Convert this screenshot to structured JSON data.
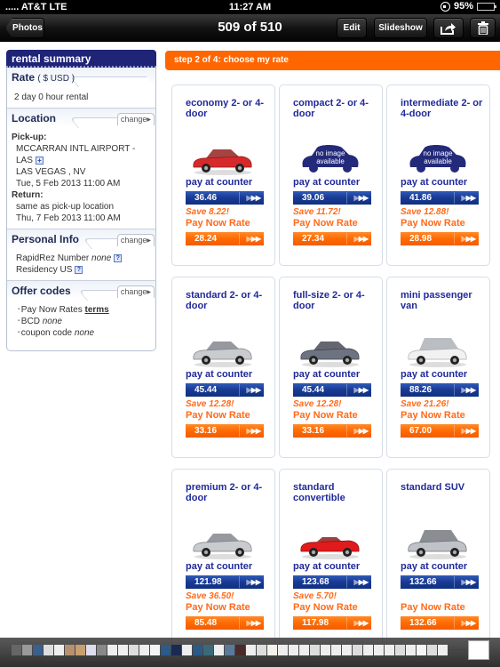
{
  "status_bar": {
    "carrier": "..... AT&T  LTE",
    "time": "11:27 AM",
    "battery": "95%",
    "battery_level": 0.95
  },
  "nav": {
    "back_label": "Photos",
    "title": "509 of 510",
    "edit_label": "Edit",
    "slideshow_label": "Slideshow"
  },
  "sidebar": {
    "header": "rental summary",
    "rate": {
      "title": "Rate",
      "currency": "( $ USD )",
      "duration": "2 day 0 hour rental"
    },
    "location": {
      "title": "Location",
      "change": "change",
      "pickup_label": "Pick-up:",
      "pickup_place_1": "MCCARRAN INTL AIRPORT -",
      "pickup_place_2": "LAS",
      "pickup_city": "LAS VEGAS ,  NV",
      "pickup_time": "Tue, 5 Feb 2013 11:00 AM",
      "return_label": "Return:",
      "return_place": "same as pick-up location",
      "return_time": "Thu, 7 Feb 2013 11:00 AM"
    },
    "personal": {
      "title": "Personal Info",
      "change": "change",
      "rapidrez_label": "RapidRez Number",
      "rapidrez_value": "none",
      "residency": "Residency US"
    },
    "offers": {
      "title": "Offer codes",
      "change": "change",
      "pay_now_label": "Pay Now Rates",
      "terms_link": "terms",
      "bcd_label": "BCD",
      "bcd_value": "none",
      "coupon_label": "coupon code",
      "coupon_value": "none"
    }
  },
  "main": {
    "step_title": "step 2 of 4: choose my rate",
    "pay_at_counter_label": "pay at counter",
    "pay_now_label": "Pay Now Rate",
    "cars": [
      {
        "name": "economy 2- or 4-door",
        "image": "red-sedan",
        "counter_price": "36.46",
        "save": "Save 8.22!",
        "pay_now_price": "28.24"
      },
      {
        "name": "compact 2- or 4-door",
        "image": "no-image",
        "counter_price": "39.06",
        "save": "Save 11.72!",
        "pay_now_price": "27.34"
      },
      {
        "name": "intermediate 2- or 4-door",
        "image": "no-image",
        "counter_price": "41.86",
        "save": "Save 12.88!",
        "pay_now_price": "28.98"
      },
      {
        "name": "standard 2- or 4-door",
        "image": "silver-sedan",
        "counter_price": "45.44",
        "save": "Save 12.28!",
        "pay_now_price": "33.16"
      },
      {
        "name": "full-size 2- or 4-door",
        "image": "gray-sedan",
        "counter_price": "45.44",
        "save": "Save 12.28!",
        "pay_now_price": "33.16"
      },
      {
        "name": "mini passenger van",
        "image": "white-van",
        "counter_price": "88.26",
        "save": "Save 21.26!",
        "pay_now_price": "67.00"
      },
      {
        "name": "premium 2- or 4-door",
        "image": "silver-sedan",
        "counter_price": "121.98",
        "save": "Save 36.50!",
        "pay_now_price": "85.48"
      },
      {
        "name": "standard convertible",
        "image": "red-convertible",
        "counter_price": "123.68",
        "save": "Save 5.70!",
        "pay_now_price": "117.98"
      },
      {
        "name": "standard SUV",
        "image": "silver-suv",
        "counter_price": "132.66",
        "save": "",
        "pay_now_price": "132.66"
      }
    ],
    "no_image_text_1": "no image",
    "no_image_text_2": "available"
  },
  "colors": {
    "brand_orange": "#ff6600",
    "brand_navy": "#1f2477",
    "link_blue": "#1f2a9a"
  }
}
